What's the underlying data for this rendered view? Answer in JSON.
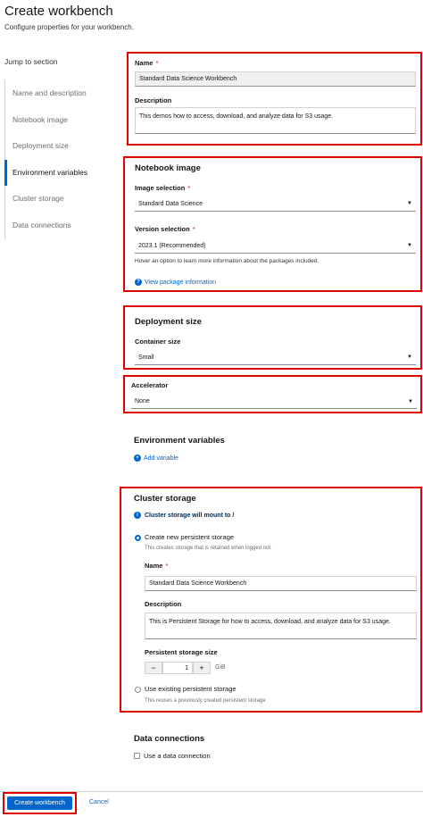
{
  "header": {
    "title": "Create workbench",
    "subtitle": "Configure properties for your workbench."
  },
  "sidebar": {
    "jump_label": "Jump to section",
    "items": [
      {
        "label": "Name and description"
      },
      {
        "label": "Notebook image"
      },
      {
        "label": "Deployment size"
      },
      {
        "label": "Environment variables"
      },
      {
        "label": "Cluster storage"
      },
      {
        "label": "Data connections"
      }
    ],
    "active": "Environment variables"
  },
  "name_section": {
    "name_label": "Name",
    "required_mark": "*",
    "name_value": "Standard Data Science Workbench",
    "description_label": "Description",
    "description_value": "This demos how to access, download, and analyze data for S3 usage."
  },
  "notebook_image": {
    "heading": "Notebook image",
    "image_selection_label": "Image selection",
    "image_selection_value": "Standard Data Science",
    "version_selection_label": "Version selection",
    "version_selection_value": "2023.1 (Recommended)",
    "hover_hint": "Hover an option to learn more information about the packages included.",
    "view_package_link": "View package information"
  },
  "deployment_size": {
    "heading": "Deployment size",
    "container_size_label": "Container size",
    "container_size_value": "Small",
    "accelerator_label": "Accelerator",
    "accelerator_value": "None"
  },
  "env_vars": {
    "heading": "Environment variables",
    "add_variable": "Add variable"
  },
  "cluster_storage": {
    "heading": "Cluster storage",
    "info_text": "Cluster storage will mount to /",
    "create_new_label": "Create new persistent storage",
    "create_new_desc": "This creates storage that is retained when logged out.",
    "name_label": "Name",
    "name_value": "Standard Data Science Workbench",
    "description_label": "Description",
    "description_value": "This is Persistent Storage for how to access, download, and analyze data for S3 usage.",
    "size_label": "Persistent storage size",
    "size_value": "1",
    "size_unit": "GiB",
    "minus": "−",
    "plus": "+",
    "use_existing_label": "Use existing persistent storage",
    "use_existing_desc": "This reuses a previously created persistent storage"
  },
  "data_connections": {
    "heading": "Data connections",
    "checkbox_label": "Use a data connection"
  },
  "footer": {
    "create_button": "Create workbench",
    "cancel_button": "Cancel"
  },
  "colors": {
    "accent": "#0066cc",
    "highlight_box": "#e00000"
  }
}
